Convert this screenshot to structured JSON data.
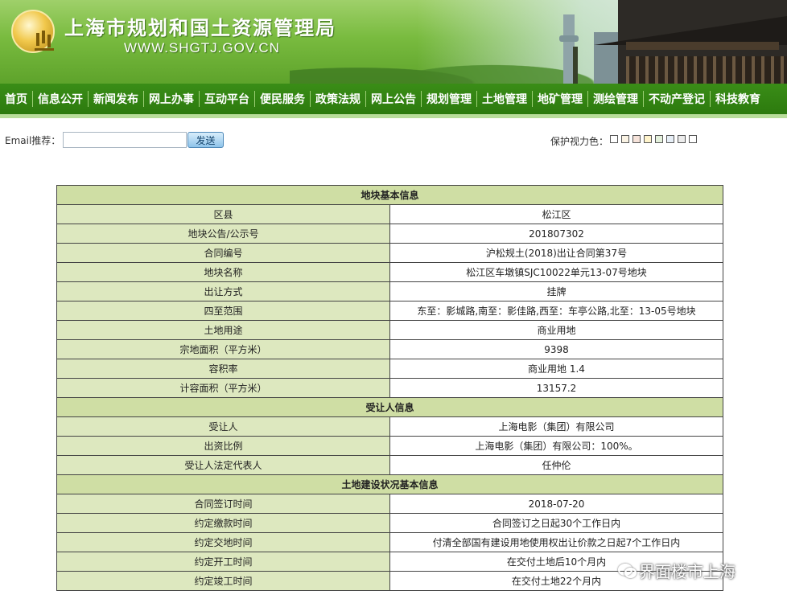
{
  "header": {
    "title": "上海市规划和国土资源管理局",
    "url": "WWW.SHGTJ.GOV.CN"
  },
  "nav": {
    "items": [
      {
        "label": "首页"
      },
      {
        "label": "信息公开"
      },
      {
        "label": "新闻发布"
      },
      {
        "label": "网上办事"
      },
      {
        "label": "互动平台"
      },
      {
        "label": "便民服务"
      },
      {
        "label": "政策法规"
      },
      {
        "label": "网上公告"
      },
      {
        "label": "规划管理"
      },
      {
        "label": "土地管理"
      },
      {
        "label": "地矿管理"
      },
      {
        "label": "测绘管理"
      },
      {
        "label": "不动产登记"
      },
      {
        "label": "科技教育"
      }
    ]
  },
  "toolbar": {
    "email_label": "Email推荐：",
    "email_value": "",
    "send_label": "发送",
    "eye_label": "保护视力色：",
    "swatch_colors": [
      "#ffffff",
      "#faf3e4",
      "#f6e3da",
      "#fff4cc",
      "#e4f1dc",
      "#e6eef6",
      "#ececec",
      "#ffffff"
    ]
  },
  "table": {
    "sections": [
      {
        "title": "地块基本信息",
        "rows": [
          {
            "label": "区县",
            "value": "松江区"
          },
          {
            "label": "地块公告/公示号",
            "value": "201807302"
          },
          {
            "label": "合同编号",
            "value": "沪松规土(2018)出让合同第37号"
          },
          {
            "label": "地块名称",
            "value": "松江区车墩镇SJC10022单元13-07号地块"
          },
          {
            "label": "出让方式",
            "value": "挂牌"
          },
          {
            "label": "四至范围",
            "value": "东至：影城路,南至：影佳路,西至：车亭公路,北至：13-05号地块"
          },
          {
            "label": "土地用途",
            "value": "商业用地"
          },
          {
            "label": "宗地面积（平方米）",
            "value": "9398"
          },
          {
            "label": "容积率",
            "value": "商业用地 1.4"
          },
          {
            "label": "计容面积（平方米）",
            "value": "13157.2"
          }
        ]
      },
      {
        "title": "受让人信息",
        "rows": [
          {
            "label": "受让人",
            "value": "上海电影（集团）有限公司"
          },
          {
            "label": "出资比例",
            "value": "上海电影（集团）有限公司：100%。"
          },
          {
            "label": "受让人法定代表人",
            "value": "任仲伦"
          }
        ]
      },
      {
        "title": "土地建设状况基本信息",
        "rows": [
          {
            "label": "合同签订时间",
            "value": "2018-07-20"
          },
          {
            "label": "约定缴款时间",
            "value": "合同签订之日起30个工作日内"
          },
          {
            "label": "约定交地时间",
            "value": "付清全部国有建设用地使用权出让价款之日起7个工作日内"
          },
          {
            "label": "约定开工时间",
            "value": "在交付土地后10个月内"
          },
          {
            "label": "约定竣工时间",
            "value": "在交付土地22个月内"
          }
        ]
      }
    ]
  },
  "watermark": {
    "text": "界面楼市上海"
  }
}
